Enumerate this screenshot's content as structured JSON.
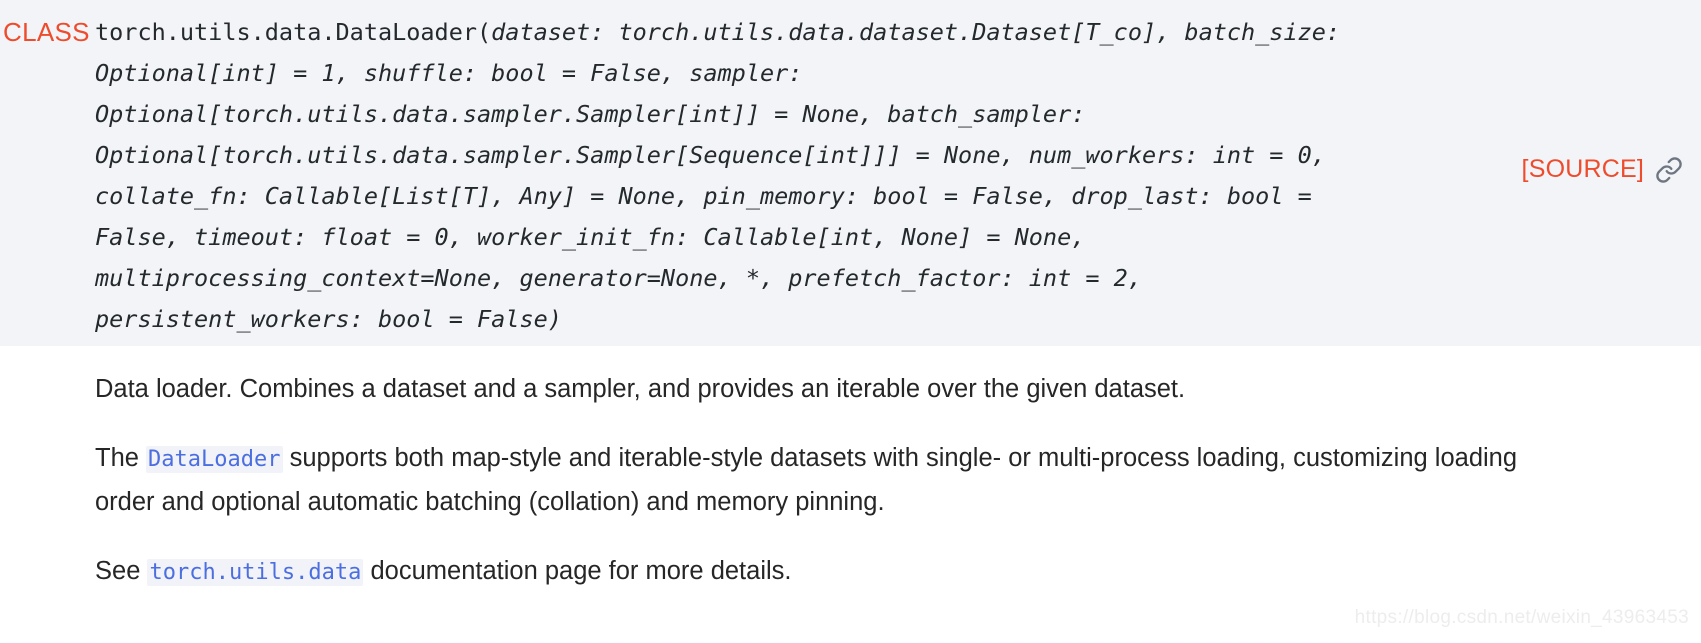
{
  "signature": {
    "class_label": "CLASS",
    "lines": [
      "torch.utils.data.DataLoader(dataset: torch.utils.data.dataset.Dataset[T_co], batch_size:",
      "Optional[int] = 1, shuffle: bool = False, sampler:",
      "Optional[torch.utils.data.sampler.Sampler[int]] = None, batch_sampler:",
      "Optional[torch.utils.data.sampler.Sampler[Sequence[int]]] = None, num_workers: int = 0,",
      "collate_fn: Callable[List[T], Any] = None, pin_memory: bool = False, drop_last: bool =",
      "False, timeout: float = 0, worker_init_fn: Callable[int, None] = None,",
      "multiprocessing_context=None, generator=None, *, prefetch_factor: int = 2,",
      "persistent_workers: bool = False)"
    ],
    "qualified_name": "torch.utils.data.DataLoader(",
    "source_label": "[SOURCE]",
    "permalink_icon": "link-chain-icon"
  },
  "body": {
    "paragraph1": "Data loader. Combines a dataset and a sampler, and provides an iterable over the given dataset.",
    "paragraph2": {
      "before_code": "The",
      "code": "DataLoader",
      "after_code": "supports both map-style and iterable-style datasets with single- or multi-process loading, customizing loading order and optional automatic batching (collation) and memory pinning."
    },
    "paragraph3": {
      "before_code": "See",
      "code": "torch.utils.data",
      "after_code": "documentation page for more details."
    }
  },
  "watermark": "https://blog.csdn.net/weixin_43963453",
  "colors": {
    "accent": "#ee4c2c",
    "code_link": "#4b6ee0",
    "sig_background": "#f3f4f7",
    "body_text": "#262626",
    "icon_gray": "#6e7681"
  }
}
